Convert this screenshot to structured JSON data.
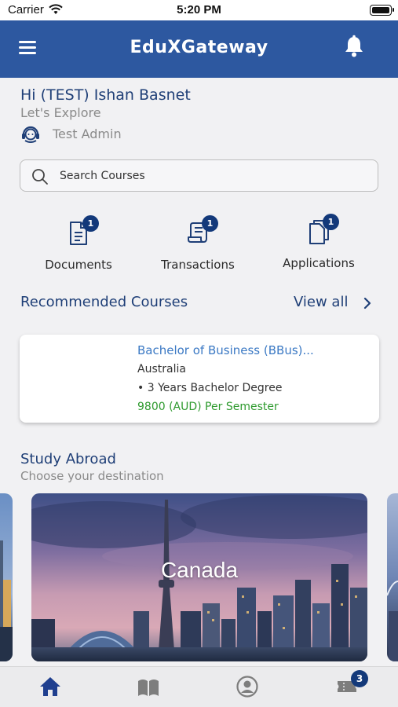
{
  "status_bar": {
    "carrier": "Carrier",
    "time": "5:20 PM"
  },
  "app_bar": {
    "title": "EduXGateway"
  },
  "user": {
    "greeting": "Hi (TEST) Ishan  Basnet",
    "subtitle": "Let's Explore",
    "role_name": "Test Admin"
  },
  "search": {
    "placeholder": "Search Courses"
  },
  "quick_actions": [
    {
      "label": "Documents",
      "badge": "1",
      "icon": "document-icon"
    },
    {
      "label": "Transactions",
      "badge": "1",
      "icon": "receipt-icon"
    },
    {
      "label": "Applications",
      "badge": "1",
      "icon": "applications-icon"
    }
  ],
  "recommended": {
    "title": "Recommended Courses",
    "view_all": "View all",
    "course": {
      "title": "Bachelor of Business (BBus)...",
      "country": "Australia",
      "duration": "• 3 Years  Bachelor Degree",
      "fee": "9800 (AUD) Per Semester"
    }
  },
  "study_abroad": {
    "title": "Study Abroad",
    "subtitle": "Choose your destination",
    "destinations": [
      {
        "name": "Canada"
      }
    ]
  },
  "tab_bar": {
    "items": [
      {
        "icon": "home-icon",
        "active": true
      },
      {
        "icon": "book-icon",
        "active": false
      },
      {
        "icon": "profile-icon",
        "active": false
      },
      {
        "icon": "ticket-icon",
        "active": false,
        "badge": "3"
      }
    ]
  },
  "colors": {
    "primary": "#2d58a0",
    "heading": "#1f3f77",
    "badge": "#13397a",
    "link": "#3b79c4",
    "price": "#2e9a2e"
  }
}
